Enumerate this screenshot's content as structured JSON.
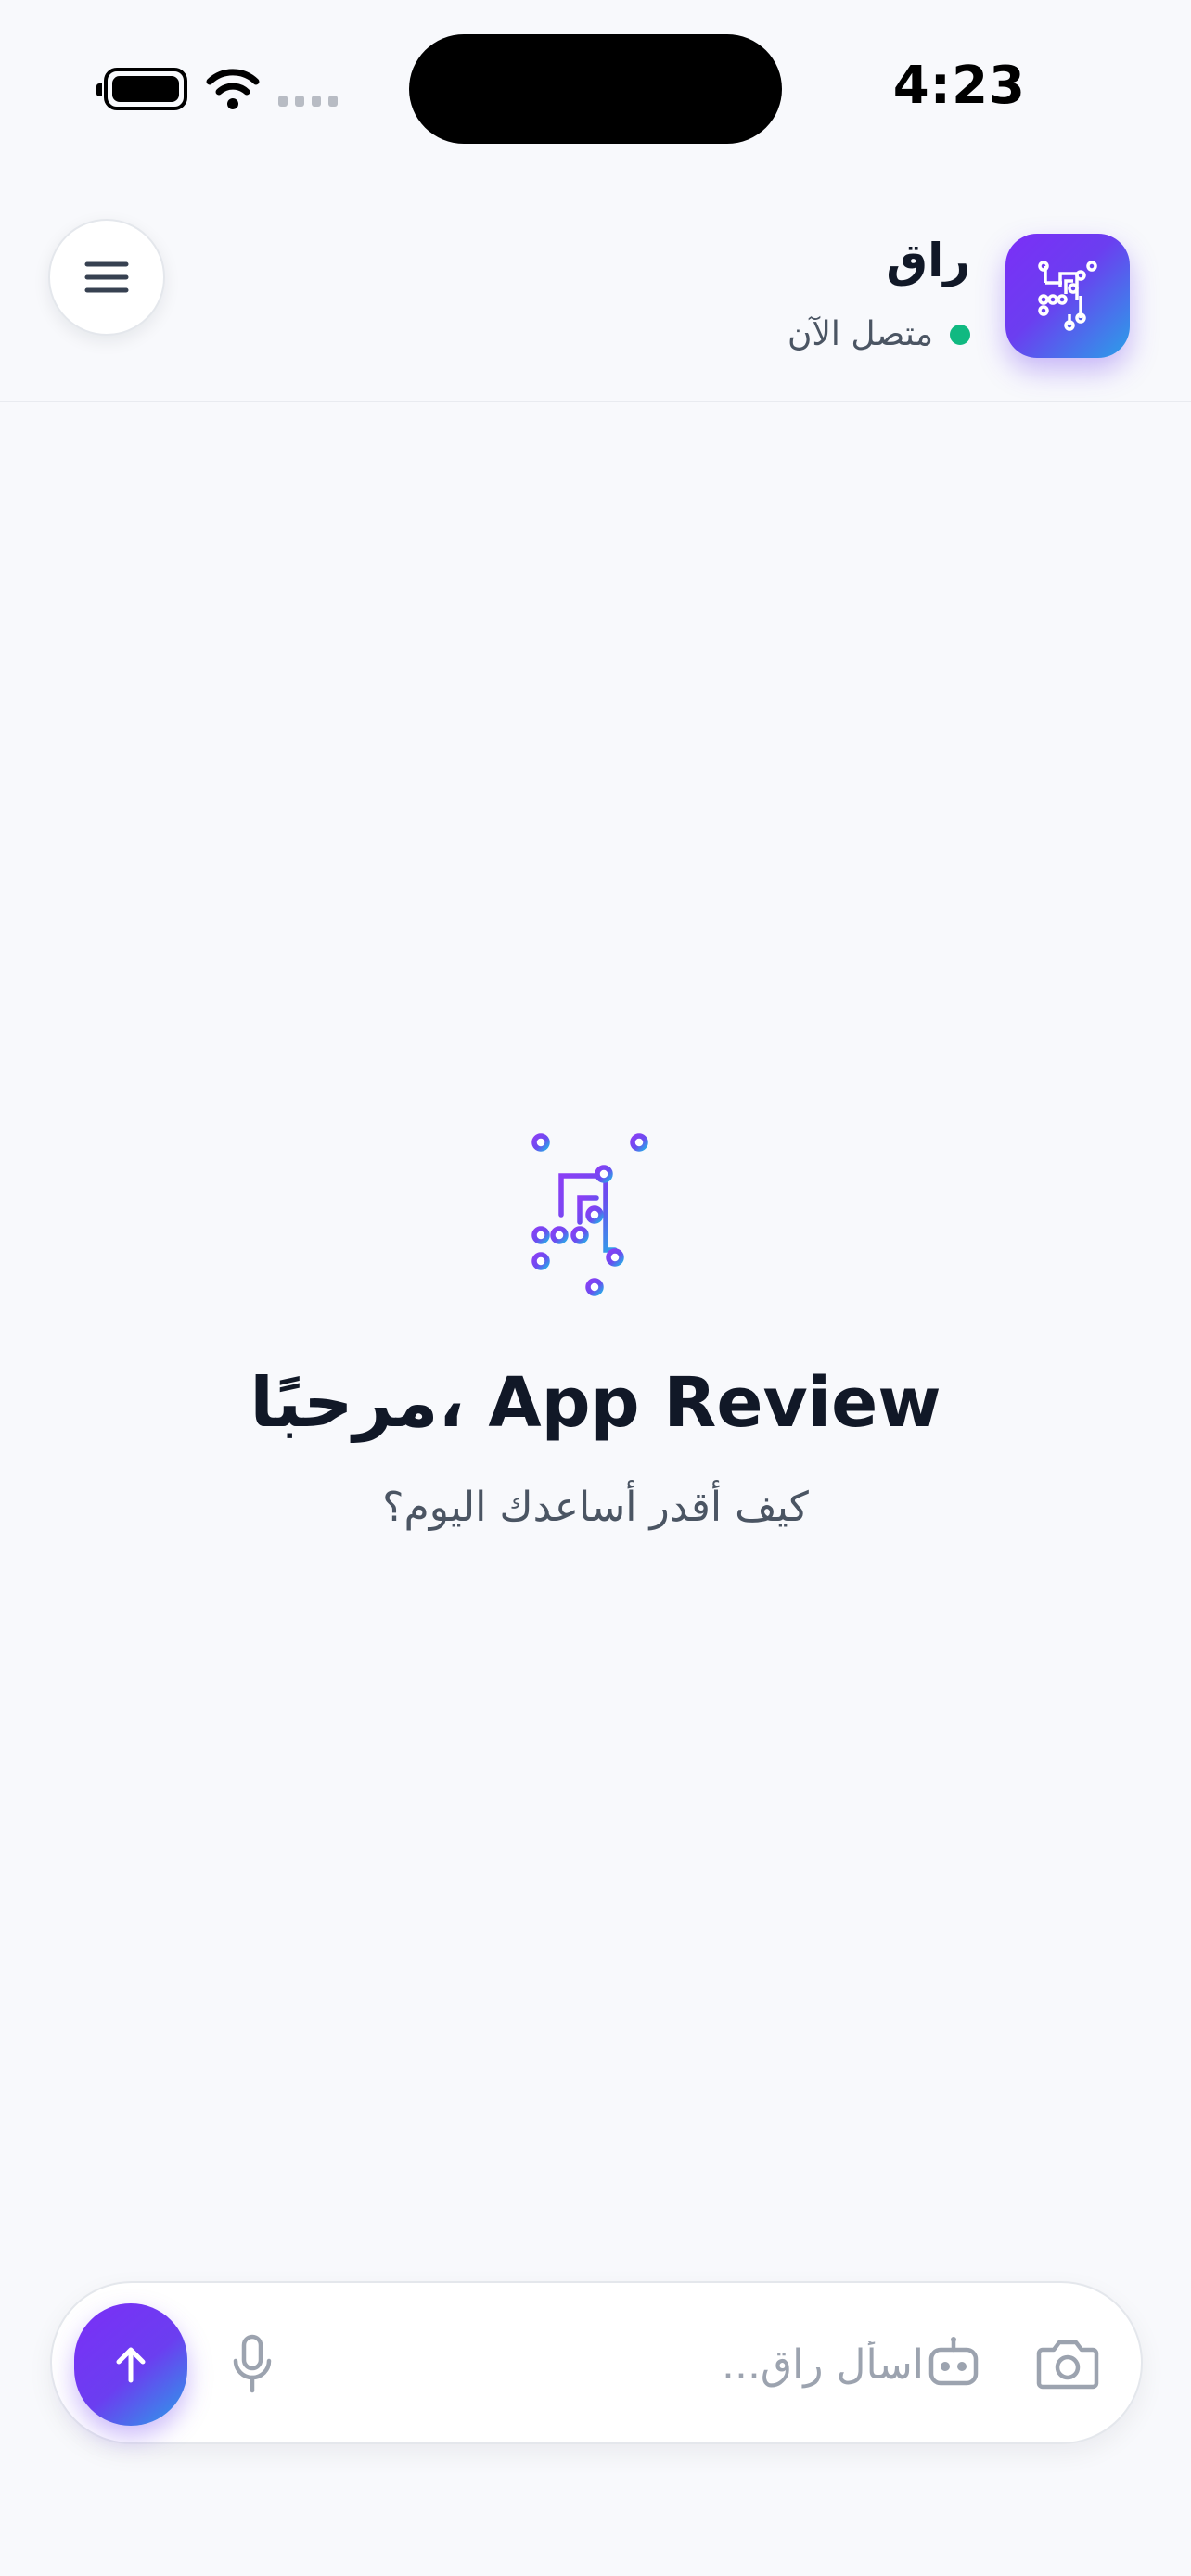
{
  "status_bar": {
    "time": "4:23"
  },
  "header": {
    "app_name": "راق",
    "status_text": "متصل الآن",
    "status_color": "#10b981"
  },
  "welcome": {
    "title": "مرحبًا، App Review",
    "subtitle": "كيف أقدر أساعدك اليوم؟"
  },
  "composer": {
    "placeholder": "اسأل راق..."
  },
  "icons": {
    "menu": "hamburger-menu-icon",
    "logo": "circuit-logo-icon",
    "send": "arrow-up-icon",
    "mic": "microphone-icon",
    "bot": "robot-icon",
    "camera": "camera-icon"
  },
  "colors": {
    "accent_start": "#7b2ff7",
    "accent_end": "#2aa0e8",
    "background": "#f8f9fc"
  }
}
